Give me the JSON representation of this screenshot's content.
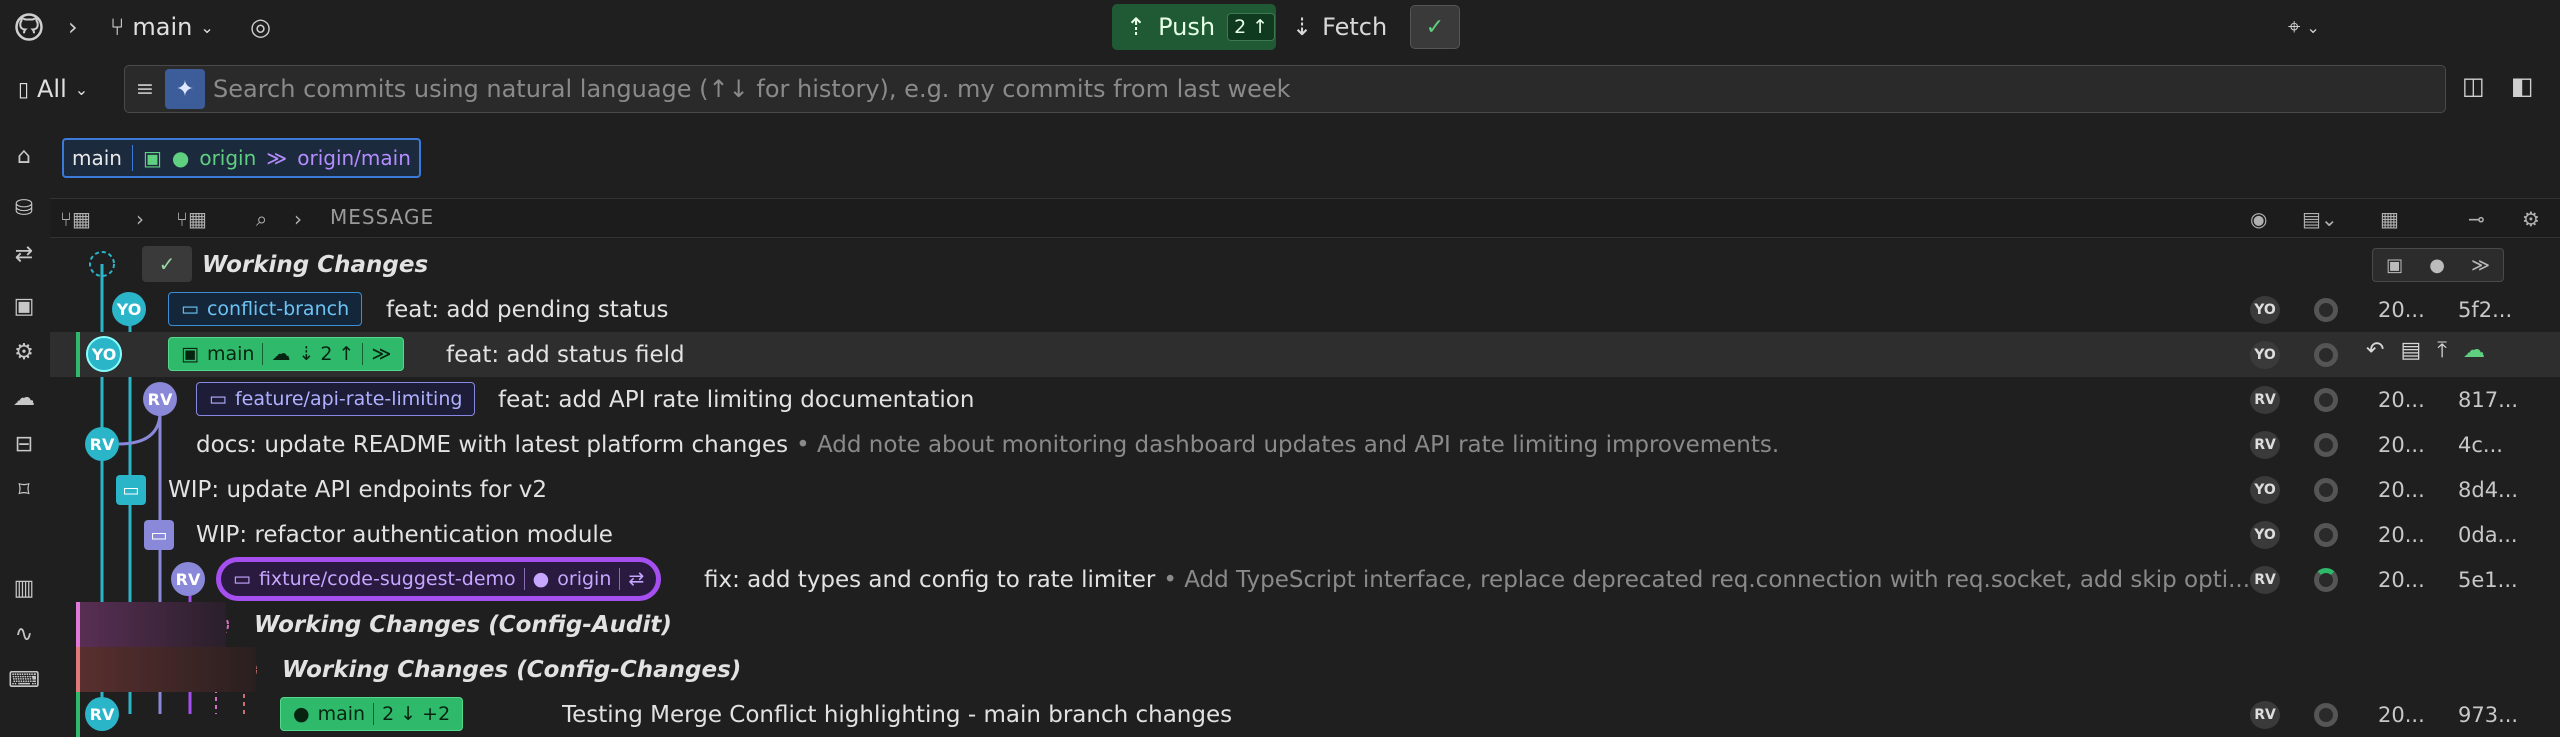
{
  "topbar": {
    "branch": "main",
    "push_label": "Push",
    "push_count": "2 ↑",
    "fetch_label": "Fetch",
    "check_glyph": "✓"
  },
  "search": {
    "filter_label": "All",
    "placeholder": "Search commits using natural language (↑↓ for history), e.g. my commits from last week"
  },
  "refs_bar": {
    "branch": "main",
    "remote": "origin",
    "remote_branch": "origin/main"
  },
  "header": {
    "message_col": "MESSAGE"
  },
  "colors": {
    "green": "#2fba6b",
    "cyan": "#2bb5c8",
    "violet": "#8a88d8",
    "purple": "#a64ff0",
    "blue": "#3c8fd2"
  },
  "rows": [
    {
      "type": "wc",
      "message": "Working Changes"
    },
    {
      "type": "commit",
      "tag": "conflict-branch",
      "message": "feat: add pending status",
      "author": "YO",
      "date": "20...",
      "sha": "5f2..."
    },
    {
      "type": "commit",
      "tag": "main",
      "tag_counts": "⇣ 2 ↑",
      "message": "feat: add status field",
      "author": "YO",
      "selected": true
    },
    {
      "type": "commit",
      "tag": "feature/api-rate-limiting",
      "message": "feat: add API rate limiting documentation",
      "author": "RV",
      "date": "20...",
      "sha": "817..."
    },
    {
      "type": "commit",
      "message": "docs: update README with latest platform changes",
      "desc": "• Add note about monitoring dashboard updates and API rate limiting improvements.",
      "author": "RV",
      "date": "20...",
      "sha": "4c..."
    },
    {
      "type": "stash",
      "message": "WIP: update API endpoints for v2",
      "author": "YO",
      "date": "20...",
      "sha": "8d4..."
    },
    {
      "type": "stash",
      "message": "WIP: refactor authentication module",
      "author": "YO",
      "date": "20...",
      "sha": "0da..."
    },
    {
      "type": "commit",
      "tag": "fixture/code-suggest-demo",
      "tag_remote": "origin",
      "message": "fix: add types and config to rate limiter",
      "desc": "• Add TypeScript interface, replace deprecated req.connection with req.socket, add skip opti...",
      "author": "RV",
      "date": "20...",
      "sha": "5e1..."
    },
    {
      "type": "wc",
      "message": "Working Changes (Config-Audit)"
    },
    {
      "type": "wc",
      "message": "Working Changes (Config-Changes)"
    },
    {
      "type": "commit",
      "tag": "main",
      "tag_counts": "2 ↓ +2",
      "message": "Testing Merge Conflict highlighting - main branch changes",
      "author": "RV",
      "date": "20...",
      "sha": "973..."
    }
  ]
}
